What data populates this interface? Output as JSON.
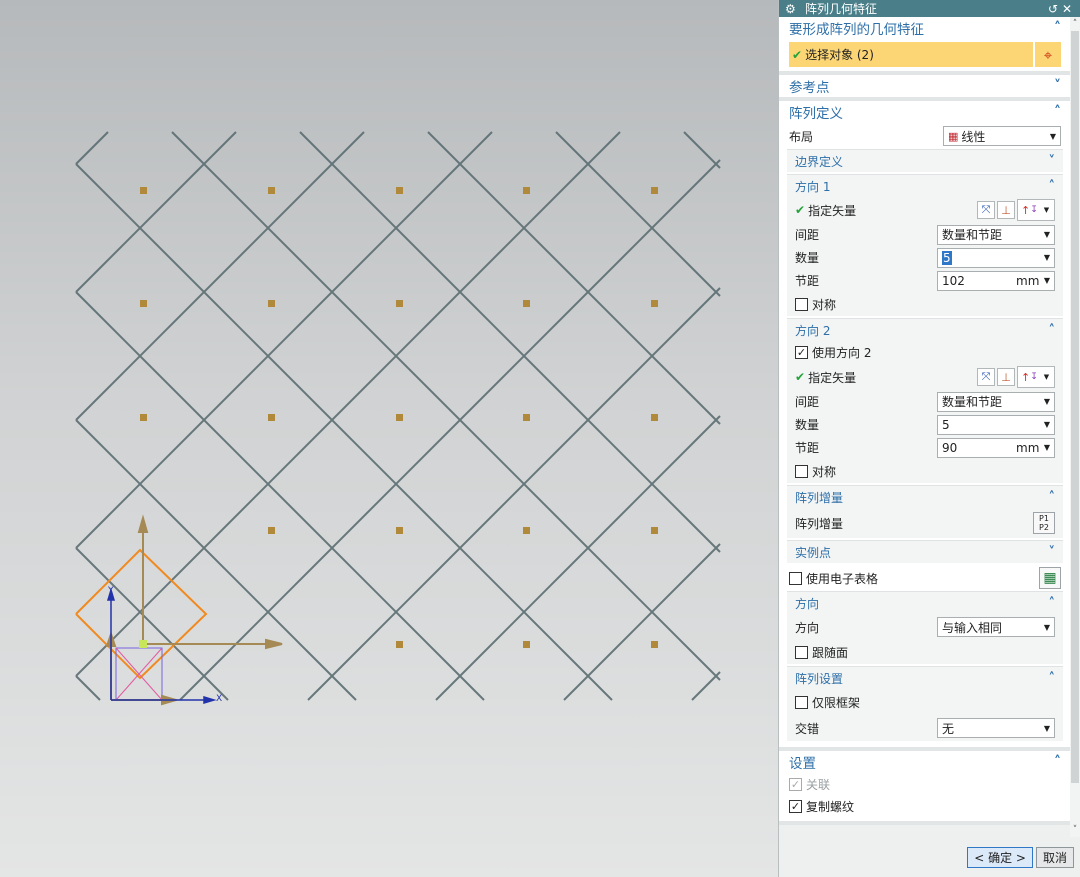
{
  "viewport": {
    "pattern": {
      "cols": 5,
      "rows": 5
    },
    "axis_x_label": "X",
    "axis_y_label": "Y"
  },
  "dialog": {
    "title": "阵列几何特征",
    "icons": {
      "app": "gear-icon",
      "reset": "reset-icon",
      "close": "close-icon"
    },
    "geom_group": {
      "title": "要形成阵列的几何特征",
      "select_label": "选择对象 (2)"
    },
    "ref_point": {
      "title": "参考点"
    },
    "array_def": {
      "title": "阵列定义",
      "layout_label": "布局",
      "layout_value": "线性",
      "boundary": {
        "title": "边界定义"
      },
      "dir1": {
        "title": "方向 1",
        "vector_label": "指定矢量",
        "spacing_label": "间距",
        "spacing_value": "数量和节距",
        "count_label": "数量",
        "count_value": "5",
        "pitch_label": "节距",
        "pitch_value": "102",
        "pitch_unit": "mm",
        "symmetric_label": "对称"
      },
      "dir2": {
        "title": "方向 2",
        "use_label": "使用方向 2",
        "vector_label": "指定矢量",
        "spacing_label": "间距",
        "spacing_value": "数量和节距",
        "count_label": "数量",
        "count_value": "5",
        "pitch_label": "节距",
        "pitch_value": "90",
        "pitch_unit": "mm",
        "symmetric_label": "对称"
      },
      "increment": {
        "title": "阵列增量",
        "label": "阵列增量"
      },
      "instance": {
        "title": "实例点"
      },
      "spreadsheet_label": "使用电子表格",
      "orientation": {
        "title": "方向",
        "dir_label": "方向",
        "dir_value": "与输入相同",
        "follow_label": "跟随面"
      },
      "array_settings": {
        "title": "阵列设置",
        "frame_label": "仅限框架",
        "stagger_label": "交错",
        "stagger_value": "无"
      }
    },
    "settings": {
      "title": "设置",
      "assoc_label": "关联",
      "copy_thread_label": "复制螺纹"
    },
    "buttons": {
      "ok": "< 确定 >",
      "cancel": "取消"
    }
  },
  "colors": {
    "title_bar": "#4a7f8a",
    "section_header": "#2e6fa8",
    "selection_highlight": "#fcd575",
    "check": "#25a33a",
    "mesh": "#5b6d72",
    "marker": "#b08a3a"
  }
}
